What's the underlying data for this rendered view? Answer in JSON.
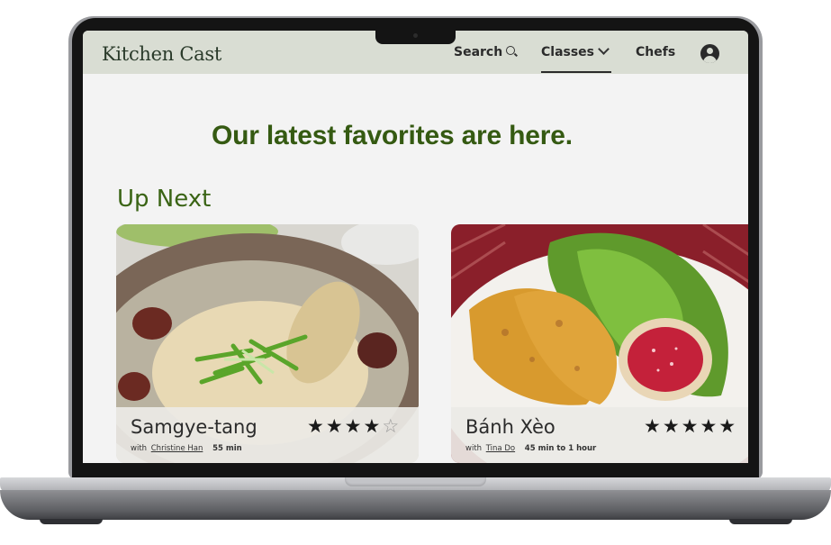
{
  "nav": {
    "brand": "Kitchen Cast",
    "search_label": "Search",
    "classes_label": "Classes",
    "chefs_label": "Chefs"
  },
  "main": {
    "headline": "Our latest favorites are here.",
    "section_title": "Up Next",
    "cards": [
      {
        "dish": "Samgye-tang",
        "with": "with",
        "chef": "Christine Han",
        "duration": "55 min",
        "stars": "★★★★",
        "empty_stars": "☆",
        "rating": 4
      },
      {
        "dish": "Bánh Xèo",
        "with": "with",
        "chef": "Tina Do",
        "duration": "45 min to 1 hour",
        "stars": "★★★★★",
        "empty_stars": "",
        "rating": 5
      }
    ]
  },
  "colors": {
    "nav_bg": "#d9ddd3",
    "headline": "#355a12",
    "screen_bg": "#f3f3f3"
  }
}
